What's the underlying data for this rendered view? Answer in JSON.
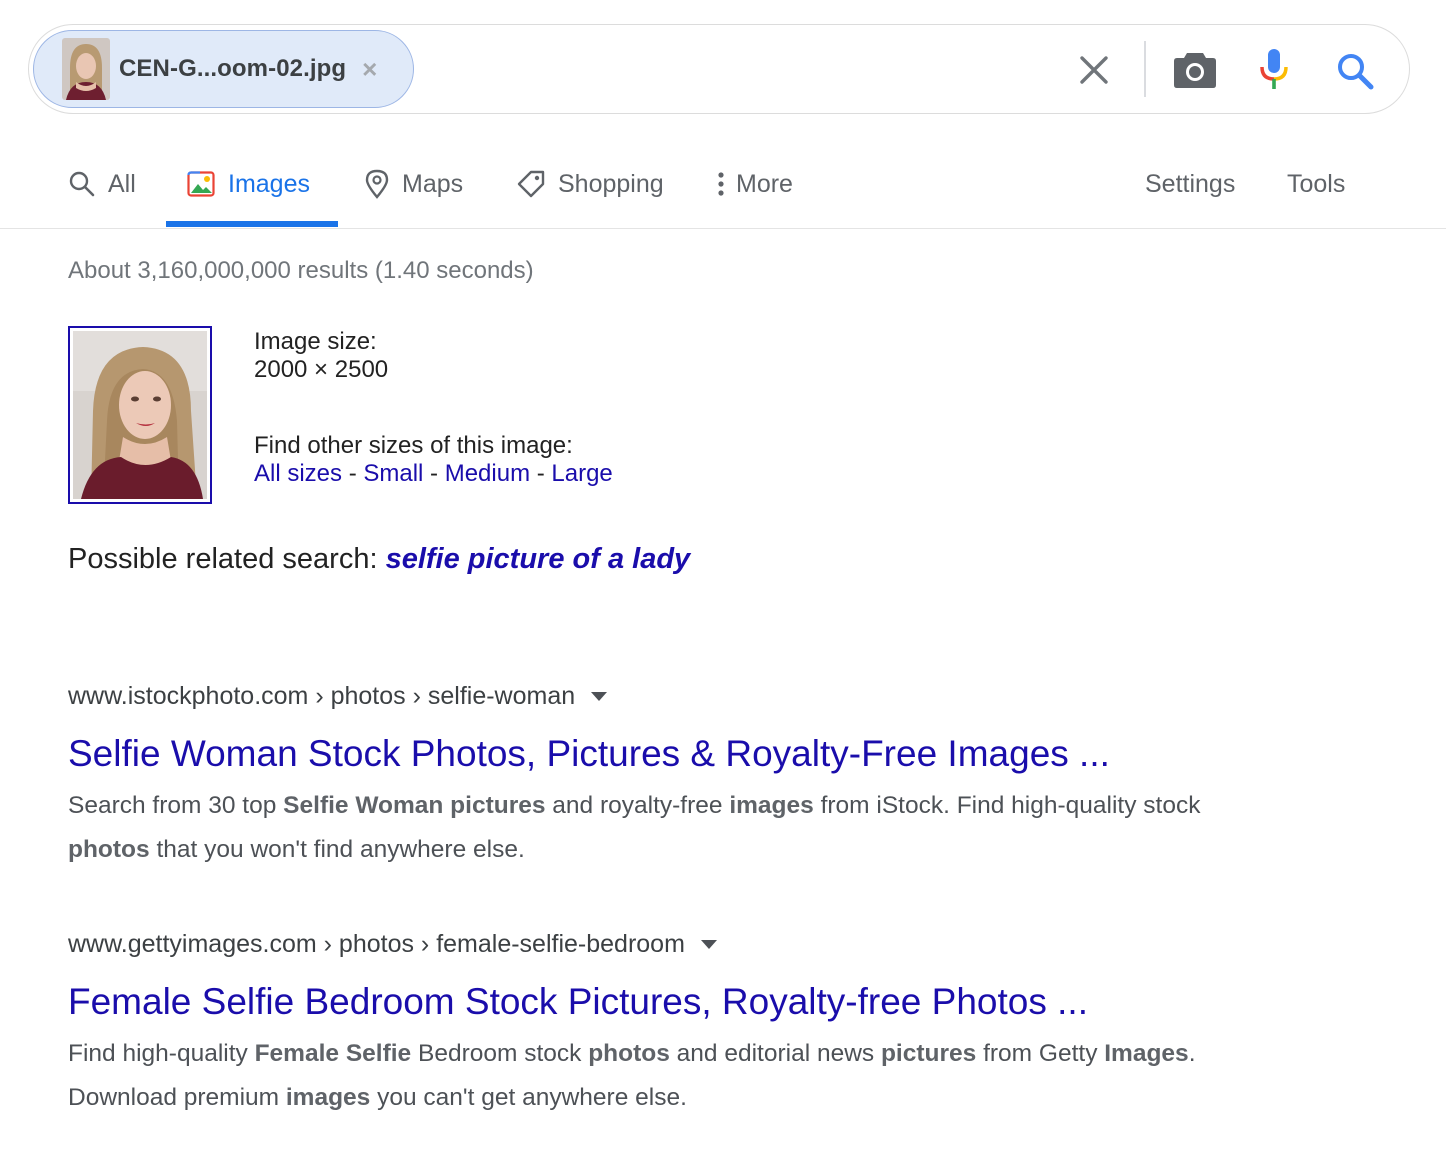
{
  "search": {
    "chip_label": "CEN-G...oom-02.jpg",
    "chip_remove": "×"
  },
  "tabs": [
    {
      "label": "All",
      "icon": "search-icon"
    },
    {
      "label": "Images",
      "icon": "image-icon",
      "active": true
    },
    {
      "label": "Maps",
      "icon": "map-pin-icon"
    },
    {
      "label": "Shopping",
      "icon": "tag-icon"
    },
    {
      "label": "More",
      "icon": "more-vert-icon"
    }
  ],
  "tools": {
    "settings": "Settings",
    "tools": "Tools"
  },
  "stats": "About 3,160,000,000 results (1.40 seconds)",
  "image_info": {
    "size_label": "Image size:",
    "size_value": "2000 × 2500",
    "other_label": "Find other sizes of this image:",
    "all_sizes": "All sizes",
    "small": "Small",
    "medium": "Medium",
    "large": "Large",
    "sep": " - "
  },
  "related": {
    "label": "Possible related search: ",
    "query": "selfie picture of a lady"
  },
  "results": [
    {
      "domain": "www.istockphoto.com",
      "path": " › photos › selfie-woman",
      "title": "Selfie Woman Stock Photos, Pictures & Royalty-Free Images ...",
      "snippet": [
        {
          "t": "Search from 30 top ",
          "b": false
        },
        {
          "t": "Selfie Woman pictures",
          "b": true
        },
        {
          "t": " and royalty-free ",
          "b": false
        },
        {
          "t": "images",
          "b": true
        },
        {
          "t": " from iStock. Find high-quality stock ",
          "b": false
        },
        {
          "t": "photos",
          "b": true
        },
        {
          "t": " that you won't find anywhere else.",
          "b": false
        }
      ]
    },
    {
      "domain": "www.gettyimages.com",
      "path": " › photos › female-selfie-bedroom",
      "title": "Female Selfie Bedroom Stock Pictures, Royalty-free Photos ...",
      "snippet": [
        {
          "t": "Find high-quality ",
          "b": false
        },
        {
          "t": "Female Selfie",
          "b": true
        },
        {
          "t": " Bedroom stock ",
          "b": false
        },
        {
          "t": "photos",
          "b": true
        },
        {
          "t": " and editorial news ",
          "b": false
        },
        {
          "t": "pictures",
          "b": true
        },
        {
          "t": " from Getty ",
          "b": false
        },
        {
          "t": "Images",
          "b": true
        },
        {
          "t": ". Download premium ",
          "b": false
        },
        {
          "t": "images",
          "b": true
        },
        {
          "t": " you can't get anywhere else.",
          "b": false
        }
      ]
    }
  ],
  "colors": {
    "link": "#1a0dab",
    "active_tab": "#1a73e8",
    "chip_bg": "#e0eaf9",
    "mic_blue": "#4285f4",
    "mic_red": "#ea4335",
    "mic_yellow": "#fbbc04",
    "mic_green": "#34a853"
  }
}
